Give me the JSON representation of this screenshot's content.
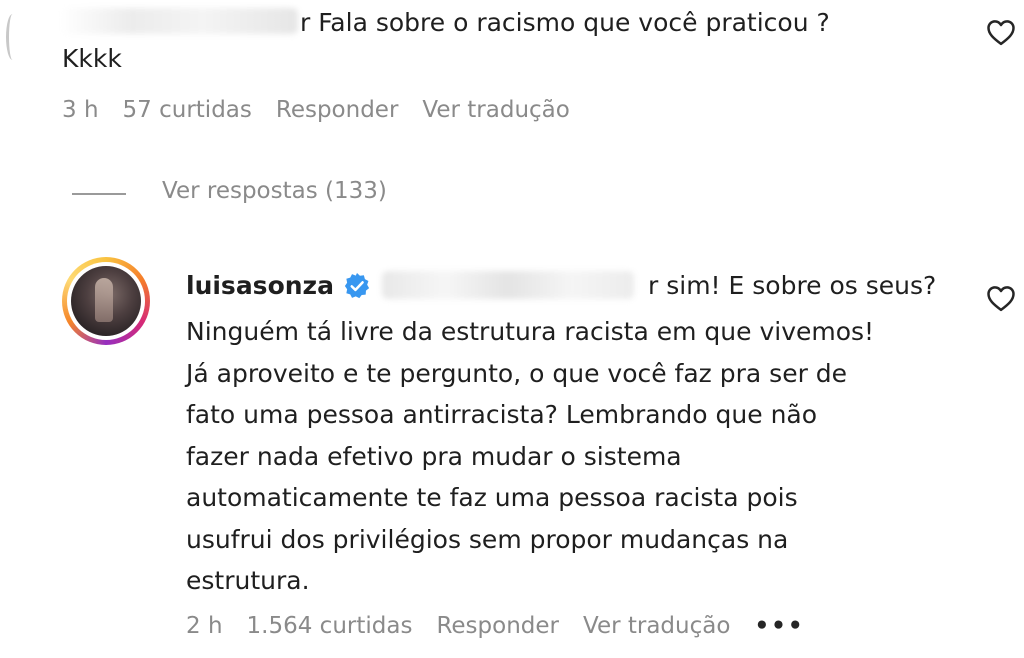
{
  "comment1": {
    "text": "r Fala sobre o racismo que você praticou ?",
    "text_line2": "Kkkk",
    "time": "3 h",
    "likes": "57 curtidas",
    "reply_label": "Responder",
    "translate_label": "Ver tradução"
  },
  "replies_toggle": {
    "label": "Ver respostas (133)"
  },
  "reply": {
    "username": "luisasonza",
    "first_line": "r sim! E sobre os seus?",
    "body_lines": [
      "Ninguém tá livre da estrutura racista em que vivemos!",
      "Já aproveito e te pergunto, o que você faz pra ser de",
      "fato uma pessoa antirracista? Lembrando que não",
      "fazer nada efetivo pra mudar o sistema",
      "automaticamente te faz uma pessoa racista pois",
      "usufrui dos privilégios sem propor mudanças na",
      "estrutura."
    ],
    "time": "2 h",
    "likes": "1.564 curtidas",
    "reply_label": "Responder",
    "translate_label": "Ver tradução",
    "more": "•••"
  },
  "colors": {
    "verified_blue": "#3897f0",
    "meta_gray": "#8a8a8a",
    "text": "#1f1f1f"
  },
  "icons": {
    "like": "heart-outline-icon",
    "verified": "verified-badge-icon",
    "more": "more-options-icon"
  }
}
